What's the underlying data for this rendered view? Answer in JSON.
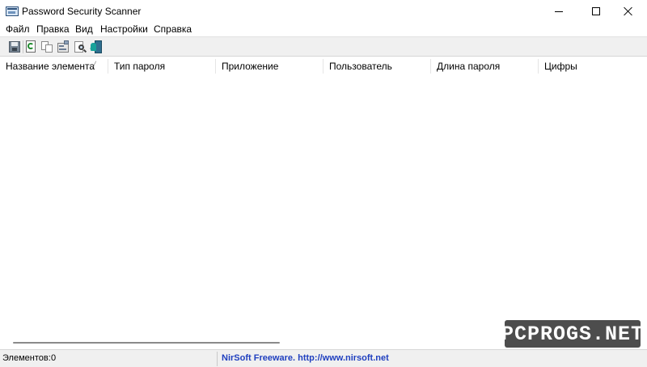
{
  "window": {
    "title": "Password Security Scanner"
  },
  "menu": [
    "Файл",
    "Правка",
    "Вид",
    "Настройки",
    "Справка"
  ],
  "toolbar": {
    "buttons": [
      "save-icon",
      "refresh-icon",
      "copy-icon",
      "properties-icon",
      "find-icon",
      "exit-icon"
    ]
  },
  "columns": [
    "Название элемента",
    "Тип пароля",
    "Приложение",
    "Пользователь",
    "Длина пароля",
    "Цифры"
  ],
  "rows": [],
  "status": {
    "count_label": "Элементов:",
    "count_value": "0",
    "link_text": "NirSoft Freeware.  http://www.nirsoft.net"
  },
  "watermark": {
    "text": "PCPROGS.NET"
  },
  "colors": {
    "link": "#1f3fbf",
    "watermark_bg": "#4d4d4d",
    "toolbar_bg": "#f0f0f0"
  }
}
